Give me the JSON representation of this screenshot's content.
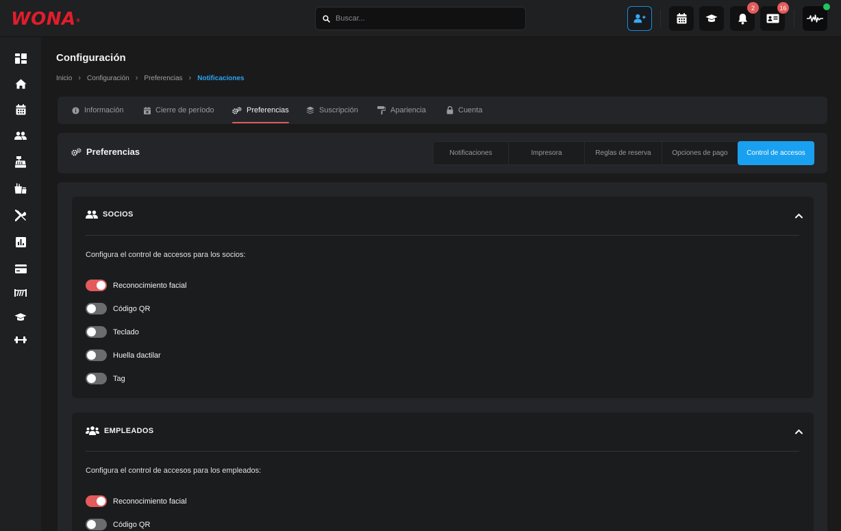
{
  "brand": {
    "name": "WONA",
    "mark": "®",
    "color": "#e11d2b"
  },
  "search": {
    "placeholder": "Buscar..."
  },
  "topbar": {
    "buttons": [
      {
        "icon": "add-user-icon"
      },
      {
        "icon": "calendar-icon"
      },
      {
        "icon": "graduation-cap-icon"
      },
      {
        "icon": "bell-icon",
        "badge": "2"
      },
      {
        "icon": "id-card-icon",
        "badge": "16"
      },
      {
        "icon": "gym-logo-avatar"
      }
    ]
  },
  "sidebar": {
    "items": [
      {
        "icon": "dashboard-icon"
      },
      {
        "icon": "home-icon"
      },
      {
        "icon": "calendar-icon"
      },
      {
        "icon": "users-icon"
      },
      {
        "icon": "cash-register-icon"
      },
      {
        "icon": "shop-icon"
      },
      {
        "icon": "tools-icon"
      },
      {
        "icon": "report-icon"
      },
      {
        "icon": "credit-card-icon"
      },
      {
        "icon": "turnstile-icon"
      },
      {
        "icon": "graduation-cap-icon"
      },
      {
        "icon": "dumbbell-icon"
      }
    ]
  },
  "page": {
    "title": "Configuración",
    "breadcrumb": [
      "Inicio",
      "Configuración",
      "Preferencias",
      "Notificaciones"
    ]
  },
  "tabs": [
    {
      "label": "Información",
      "icon": "info-icon"
    },
    {
      "label": "Cierre de período",
      "icon": "calendar-x-icon"
    },
    {
      "label": "Preferencias",
      "icon": "gears-icon",
      "active": true
    },
    {
      "label": "Suscripción",
      "icon": "layers-icon"
    },
    {
      "label": "Apariencia",
      "icon": "paint-roller-icon"
    },
    {
      "label": "Cuenta",
      "icon": "lock-icon"
    }
  ],
  "preferences": {
    "title": "Preferencias",
    "segments": [
      "Notificaciones",
      "Impresora",
      "Reglas de reserva",
      "Opciones de pago",
      "Control de accesos"
    ],
    "active_segment": "Control de accesos"
  },
  "sections": [
    {
      "title": "SOCIOS",
      "description": "Configura el control de accesos para los socios:",
      "options": [
        {
          "label": "Reconocimiento facial",
          "on": true
        },
        {
          "label": "Código QR",
          "on": false
        },
        {
          "label": "Teclado",
          "on": false
        },
        {
          "label": "Huella dactilar",
          "on": false
        },
        {
          "label": "Tag",
          "on": false
        }
      ]
    },
    {
      "title": "EMPLEADOS",
      "description": "Configura el control de accesos para los empleados:",
      "options": [
        {
          "label": "Reconocimiento facial",
          "on": true
        },
        {
          "label": "Código QR",
          "on": false
        }
      ]
    }
  ],
  "colors": {
    "accent": "#1aa0f0",
    "toggle_on": "#e35b5b",
    "online": "#22c55e"
  }
}
